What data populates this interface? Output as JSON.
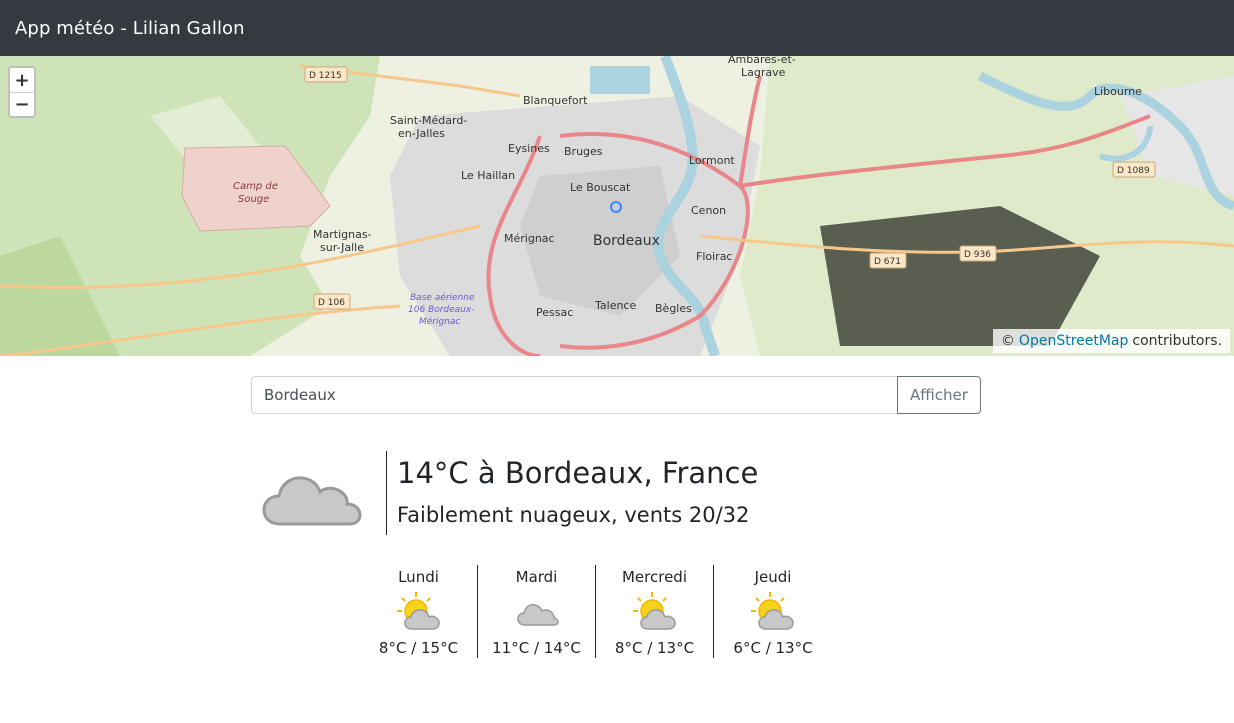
{
  "app": {
    "title": "App météo - Lilian Gallon"
  },
  "map": {
    "zoom_in": "+",
    "zoom_out": "−",
    "attribution_prefix": "©",
    "attribution_link": "OpenStreetMap",
    "attribution_suffix": "contributors.",
    "labels": {
      "bordeaux": "Bordeaux",
      "blanquefort": "Blanquefort",
      "saint_medard_1": "Saint-Médard-",
      "saint_medard_2": "en-Jalles",
      "eysines": "Eysines",
      "bruges": "Bruges",
      "le_haillan": "Le Haillan",
      "le_bouscat": "Le Bouscat",
      "lormont": "Lormont",
      "cenon": "Cenon",
      "merignac": "Mérignac",
      "martignas_1": "Martignas-",
      "martignas_2": "sur-Jalle",
      "floirac": "Floirac",
      "talence": "Talence",
      "pessac": "Pessac",
      "begles": "Bègles",
      "libourne": "Libourne",
      "ambares_1": "Ambarès-et-",
      "ambares_2": "Lagrave",
      "camp_1": "Camp de",
      "camp_2": "Souge",
      "base_1": "Base aérienne",
      "base_2": "106 Bordeaux-",
      "base_3": "Mérignac",
      "d1215": "D 1215",
      "d106": "D 106",
      "d671": "D 671",
      "d936": "D 936",
      "d1089": "D 1089"
    }
  },
  "search": {
    "value": "Bordeaux",
    "button": "Afficher"
  },
  "current": {
    "icon": "cloud-icon",
    "title": "14°C à Bordeaux, France",
    "description": "Faiblement nuageux, vents 20/32"
  },
  "forecast": [
    {
      "day": "Lundi",
      "icon": "sun-cloud-icon",
      "temps": "8°C / 15°C"
    },
    {
      "day": "Mardi",
      "icon": "cloud-icon",
      "temps": "11°C / 14°C"
    },
    {
      "day": "Mercredi",
      "icon": "sun-cloud-icon",
      "temps": "8°C / 13°C"
    },
    {
      "day": "Jeudi",
      "icon": "sun-cloud-icon",
      "temps": "6°C / 13°C"
    }
  ],
  "colors": {
    "navbar": "#343a40",
    "sun": "#f7d21a",
    "cloud": "#c8c8c8",
    "link": "#0078a8"
  }
}
